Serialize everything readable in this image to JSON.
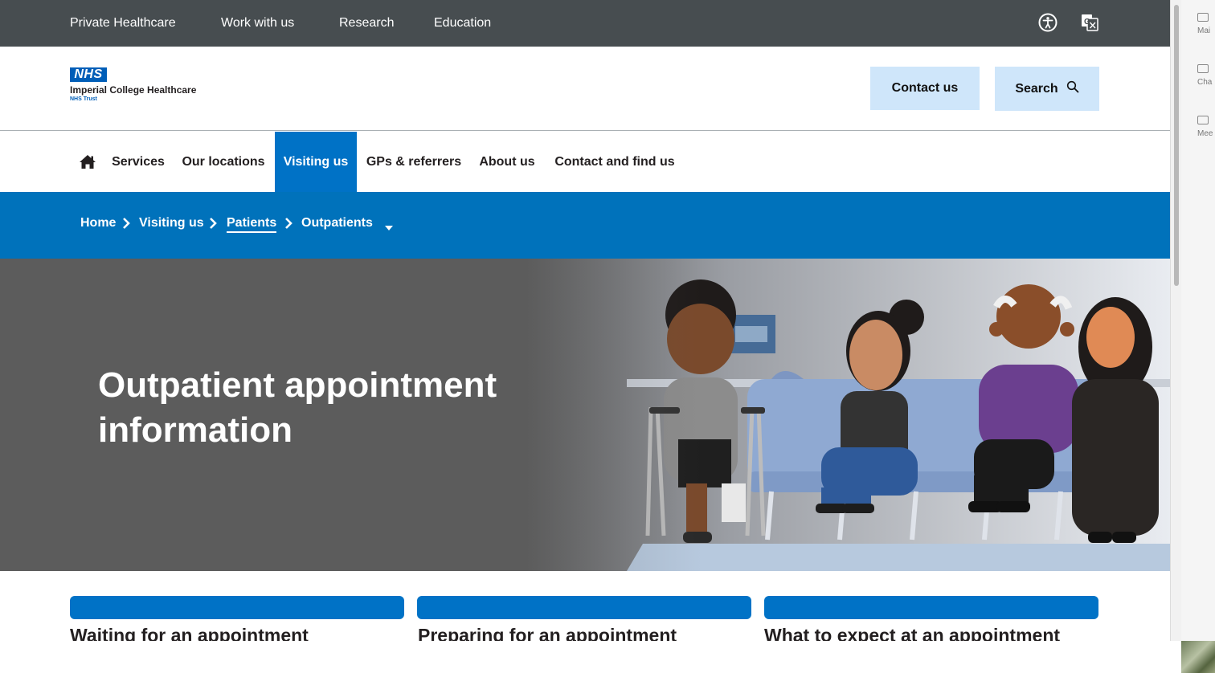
{
  "topbar": {
    "links": [
      "Private Healthcare",
      "Work with us",
      "Research",
      "Education"
    ],
    "accessibility_icon": "accessibility-icon",
    "translate_icon": "translate-icon"
  },
  "header": {
    "logo_badge": "NHS",
    "org_name": "Imperial College Healthcare",
    "org_sub": "NHS Trust",
    "contact_label": "Contact us",
    "search_label": "Search",
    "search_icon": "search-icon"
  },
  "nav": {
    "home_icon": "home-icon",
    "items": [
      "Services",
      "Our locations",
      "Visiting us",
      "GPs & referrers",
      "About us",
      "Contact and find us"
    ],
    "active": "Visiting us"
  },
  "breadcrumb": {
    "items": [
      "Home",
      "Visiting us",
      "Patients",
      "Outpatients"
    ],
    "current_icon": "caret-down-icon"
  },
  "hero": {
    "title_line1": "Outpatient appointment",
    "title_line2": "information"
  },
  "cards": [
    {
      "title": "Waiting for an appointment"
    },
    {
      "title": "Preparing for an appointment"
    },
    {
      "title": "What to expect at an appointment"
    }
  ],
  "side_panel": {
    "items": [
      "Mai",
      "Cha",
      "Mee"
    ]
  },
  "colors": {
    "nhs_blue": "#005eb8",
    "nav_blue": "#0072c6",
    "topbar": "#474d50",
    "button_bg": "#cfe6fa",
    "hero_bg": "#5c5c5c"
  }
}
